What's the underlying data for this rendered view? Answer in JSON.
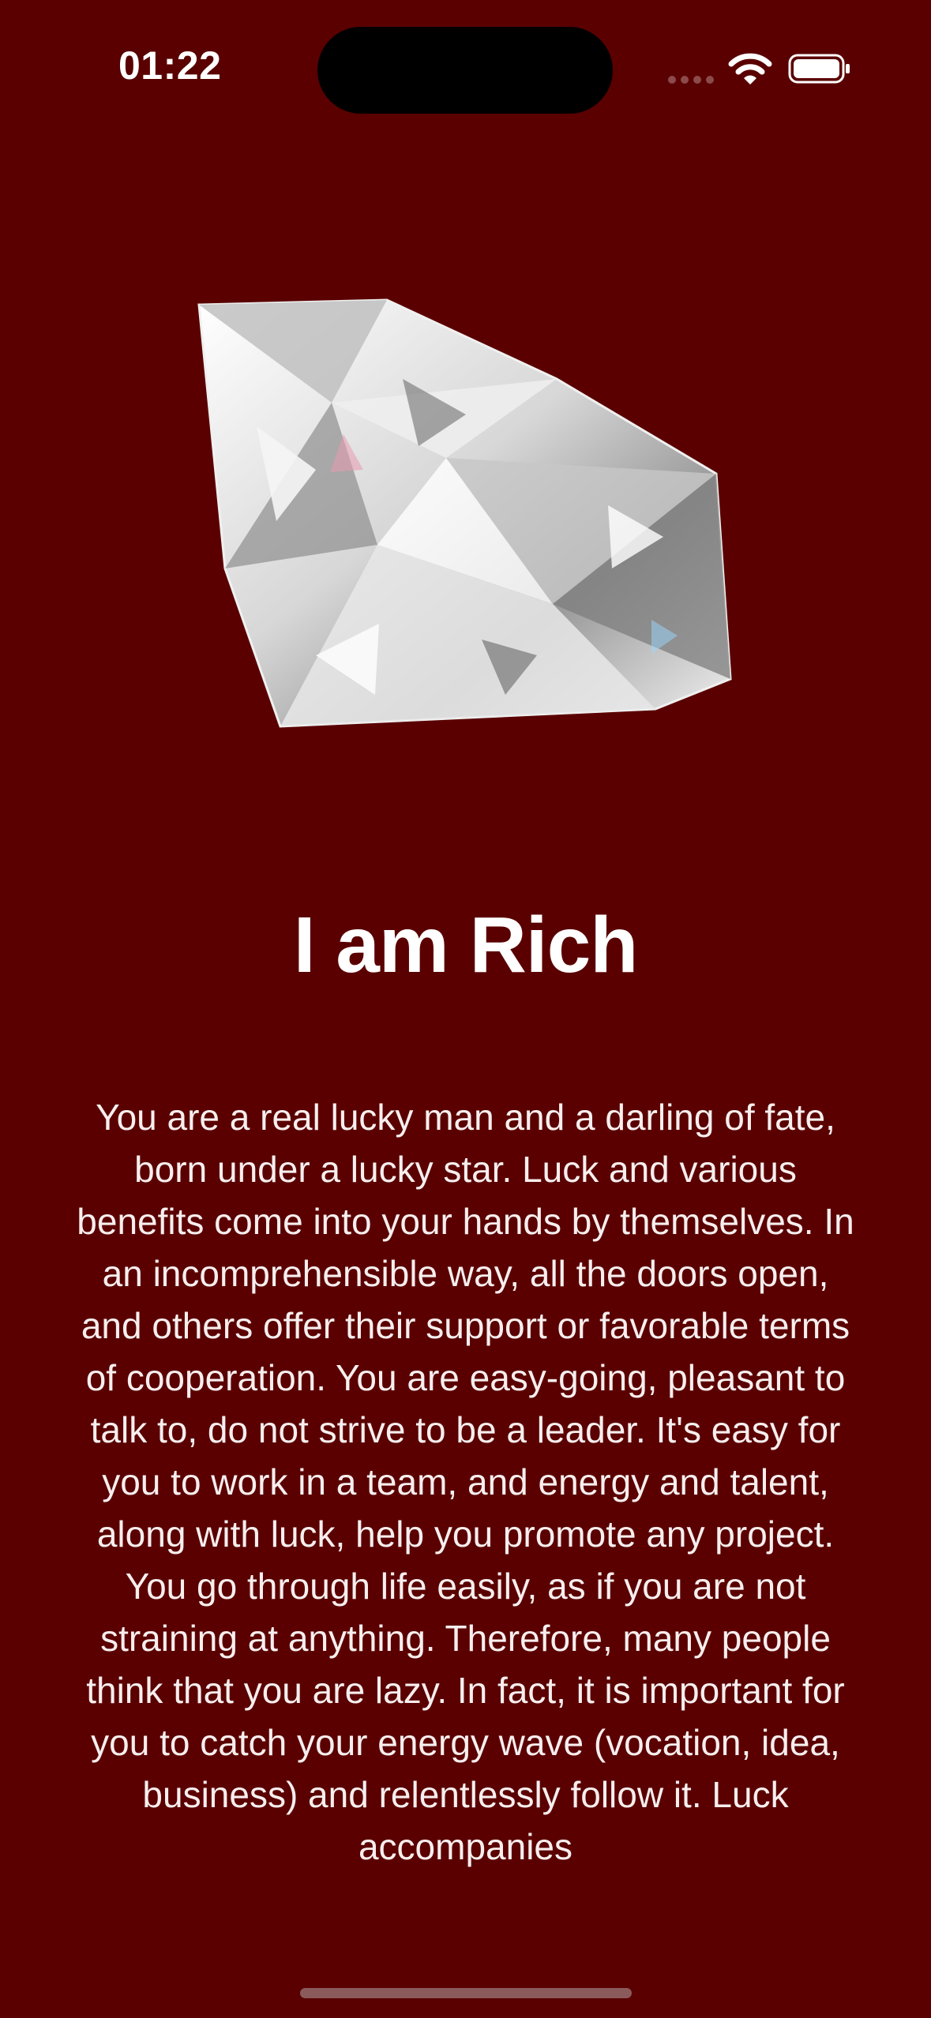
{
  "status_bar": {
    "time": "01:22",
    "icons": [
      "cellular-signal-icon",
      "wifi-icon",
      "battery-icon"
    ]
  },
  "screen": {
    "background_color": "#5a0000",
    "image": "diamond",
    "title": "I am Rich",
    "description": "You are a real lucky man and a darling of fate, born under a lucky star. Luck and various benefits come into your hands by themselves. In an incomprehensible way, all the doors open, and others offer their support or favorable terms of cooperation. You are easy-going, pleasant to talk to, do not strive to be a leader. It's easy for you to work in a team, and energy and talent, along with luck, help you promote any project. You go through life easily, as if you are not straining at anything. Therefore, many people think that you are lazy. In fact, it is important for you to catch your energy wave (vocation, idea, business) and relentlessly follow it. Luck accompanies"
  }
}
